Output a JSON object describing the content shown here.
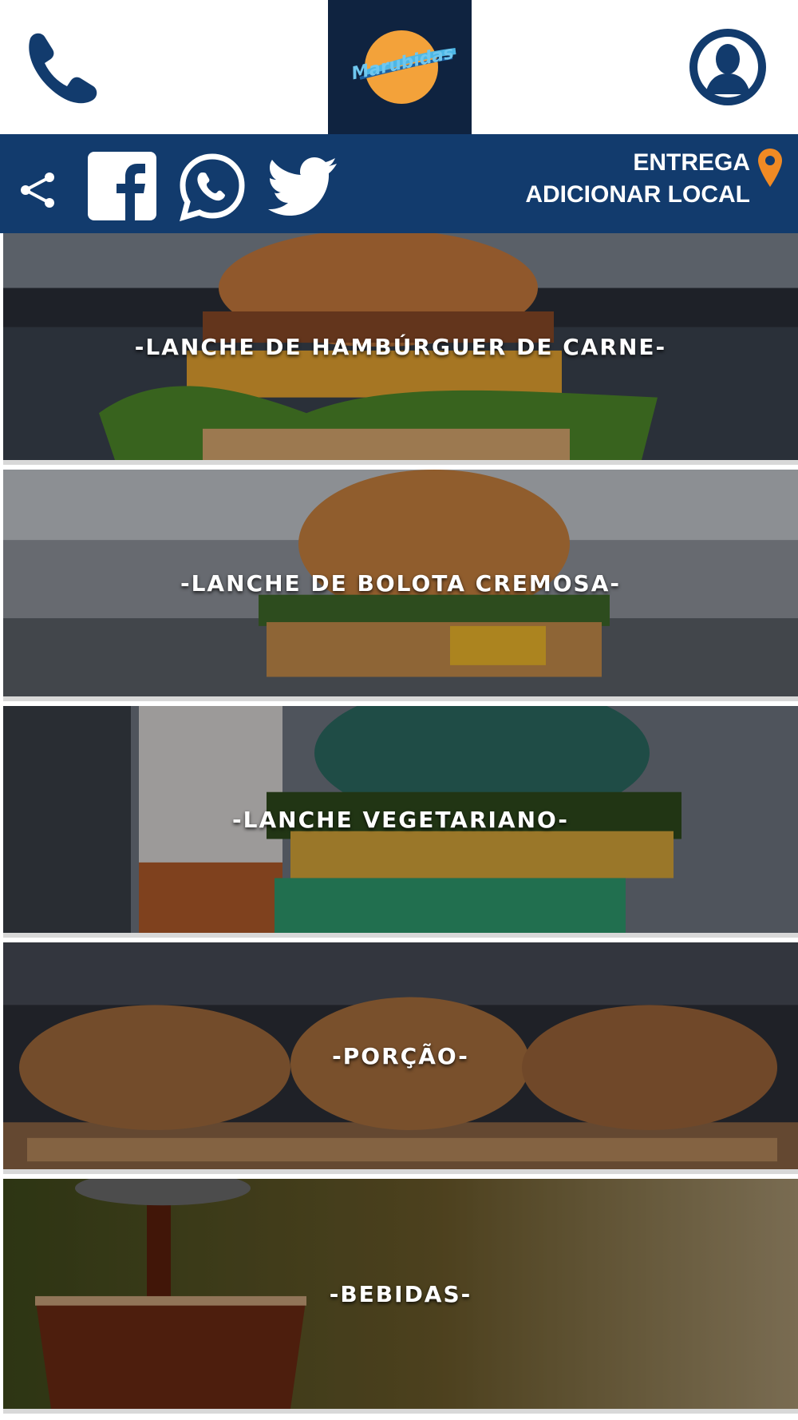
{
  "header": {
    "phone_icon": "phone-icon",
    "logo_icon": "brand-logo",
    "user_icon": "user-profile-icon"
  },
  "social": {
    "icons": [
      "share-icon",
      "facebook-icon",
      "whatsapp-icon",
      "twitter-icon"
    ],
    "delivery_line1": "ENTREGA",
    "delivery_line2": "ADICIONAR LOCAL",
    "pin_icon": "location-pin-icon",
    "pin_color": "#f08a24"
  },
  "colors": {
    "header_bg": "#ffffff",
    "logo_bg": "#0f2340",
    "bar_bg": "#123b6d",
    "icon_blue": "#123b6d"
  },
  "categories": [
    {
      "label": "-LANCHE DE HAMBÚRGUER DE CARNE-"
    },
    {
      "label": "-LANCHE DE BOLOTA CREMOSA-"
    },
    {
      "label": "-LANCHE VEGETARIANO-"
    },
    {
      "label": "-PORÇÃO-"
    },
    {
      "label": "-BEBIDAS-"
    }
  ]
}
